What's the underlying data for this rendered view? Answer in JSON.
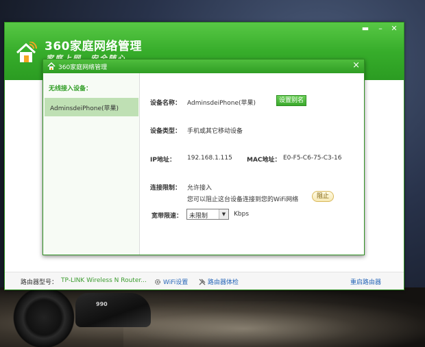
{
  "main_window": {
    "title": "360家庭网络管理",
    "slogan": "家庭上网，安全随心"
  },
  "dialog": {
    "title": "360家庭网络管理",
    "left_heading": "无线接入设备：",
    "device_item": "AdminsdeiPhone(苹果)",
    "name_label": "设备名称：",
    "name_value": "AdminsdeiPhone(苹果)",
    "rename_button": "设置别名",
    "type_label": "设备类型：",
    "type_value": "手机或其它移动设备",
    "ip_label": "IP地址：",
    "ip_value": "192.168.1.115",
    "mac_label": "MAC地址：",
    "mac_value": "E0-F5-C6-75-C3-16",
    "limit_label": "连接限制：",
    "limit_value": "允许接入",
    "limit_hint": "您可以阻止这台设备连接到您的WiFi网络",
    "block_button": "阻止",
    "speed_label": "宽带限速：",
    "speed_value": "未限制",
    "speed_unit": "Kbps"
  },
  "status_bar": {
    "router_label": "路由器型号：",
    "router_model": "TP-LINK Wireless N Router...",
    "wifi_settings": "WiFi设置",
    "router_check": "路由器体检",
    "restart_router": "重启路由器"
  },
  "desktop": {
    "bike_badge": "990"
  },
  "colors": {
    "brand_green": "#37ad2b",
    "link_blue": "#2766b8",
    "selection_green": "#bfe0b4"
  }
}
